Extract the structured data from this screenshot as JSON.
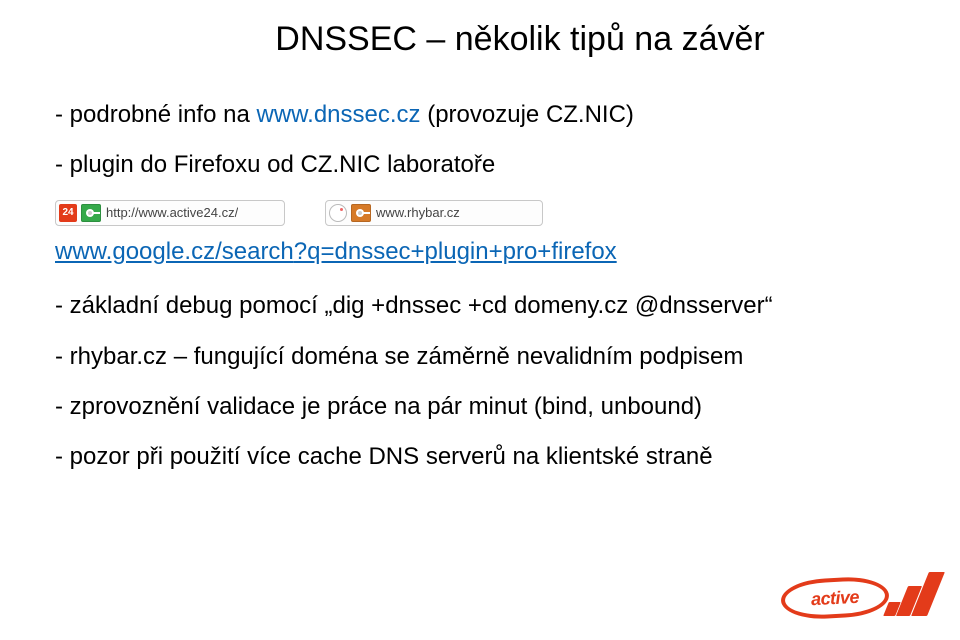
{
  "title": "DNSSEC – několik tipů na závěr",
  "lines": {
    "l1a": "- podrobné info na ",
    "l1b": "www.dnssec.cz",
    "l1c": " (provozuje CZ.NIC)",
    "l2": "- plugin do Firefoxu od CZ.NIC laboratoře",
    "link_prefix": "www.google.cz/search",
    "link_query": "?q=dnssec+plugin+pro+firefox",
    "l3": "- základní debug pomocí „dig +dnssec +cd domeny.cz @dnsserver“",
    "l4": "- rhybar.cz – fungující doména se záměrně nevalidním podpisem",
    "l5": "- zprovoznění validace je práce na pár minut (bind, unbound)",
    "l6": "- pozor při použití více cache DNS serverů na klientské straně"
  },
  "urlbar": {
    "left": {
      "favicon_text": "24",
      "url": "http://www.active24.cz/"
    },
    "right": {
      "url": "www.rhybar.cz"
    }
  },
  "logo": {
    "text": "active"
  }
}
